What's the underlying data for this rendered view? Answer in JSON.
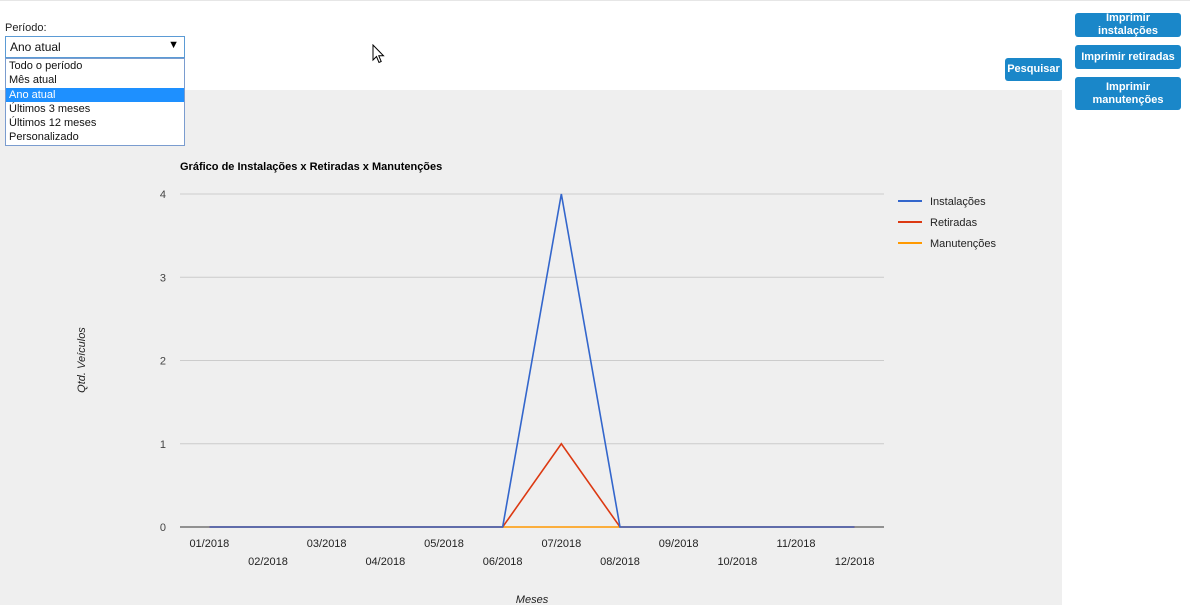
{
  "filters": {
    "period_label": "Período:",
    "selected": "Ano atual",
    "options": [
      "Todo o período",
      "Mês atual",
      "Ano atual",
      "Últimos 3 meses",
      "Últimos 12 meses",
      "Personalizado"
    ],
    "selected_index": 2
  },
  "buttons": {
    "search": "Pesquisar",
    "print_installs": "Imprimir instalações",
    "print_removals": "Imprimir retiradas",
    "print_maintenance": "Imprimir manutenções"
  },
  "colors": {
    "button": "#1a87c9",
    "instalacoes": "#3366cc",
    "retiradas": "#dc3912",
    "manutencoes": "#ff9900"
  },
  "chart_data": {
    "type": "line",
    "title": "Gráfico de Instalações x Retiradas x Manutenções",
    "xlabel": "Meses",
    "ylabel": "Qtd. Veículos",
    "categories": [
      "01/2018",
      "02/2018",
      "03/2018",
      "04/2018",
      "05/2018",
      "06/2018",
      "07/2018",
      "08/2018",
      "09/2018",
      "10/2018",
      "11/2018",
      "12/2018"
    ],
    "ylim": [
      0,
      4
    ],
    "yticks": [
      0,
      1,
      2,
      3,
      4
    ],
    "grid": true,
    "legend_position": "right",
    "series": [
      {
        "name": "Instalações",
        "values": [
          0,
          0,
          0,
          0,
          0,
          0,
          4,
          0,
          0,
          0,
          0,
          0
        ]
      },
      {
        "name": "Retiradas",
        "values": [
          0,
          0,
          0,
          0,
          0,
          0,
          1,
          0,
          0,
          0,
          0,
          0
        ]
      },
      {
        "name": "Manutenções",
        "values": [
          0,
          0,
          0,
          0,
          0,
          0,
          0,
          0,
          0,
          0,
          0,
          0
        ]
      }
    ]
  }
}
